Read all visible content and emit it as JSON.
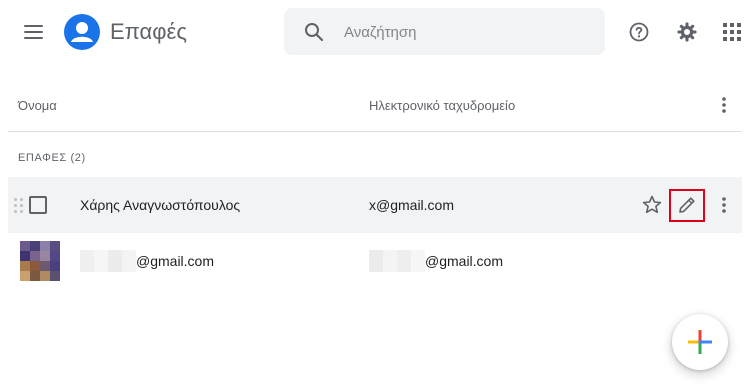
{
  "app": {
    "title": "Επαφές",
    "brand_color": "#1a73e8"
  },
  "search": {
    "placeholder": "Αναζήτηση",
    "value": ""
  },
  "icons": {
    "menu": "menu-icon",
    "logo": "contacts-person-icon",
    "search": "search-icon",
    "help": "help-icon",
    "settings": "gear-icon",
    "apps": "apps-grid-icon",
    "more": "more-vert-icon",
    "star": "star-outline-icon",
    "edit": "pencil-icon",
    "add": "plus-icon"
  },
  "table": {
    "columns": [
      "Όνομα",
      "Ηλεκτρονικό ταχυδρομείο"
    ],
    "section_label": "ΕΠΑΦΕΣ (2)",
    "rows": [
      {
        "name": "Χάρης Αναγνωστόπουλος",
        "email": "x@gmail.com",
        "hovered": true
      },
      {
        "name": "@gmail.com",
        "email": "@gmail.com",
        "hovered": false
      }
    ]
  },
  "colors": {
    "highlight_box": "#e0001b",
    "row_hover": "#f1f3f4",
    "fab_colors": [
      "#ea4335",
      "#4285f4",
      "#34a853",
      "#fbbc04"
    ]
  }
}
